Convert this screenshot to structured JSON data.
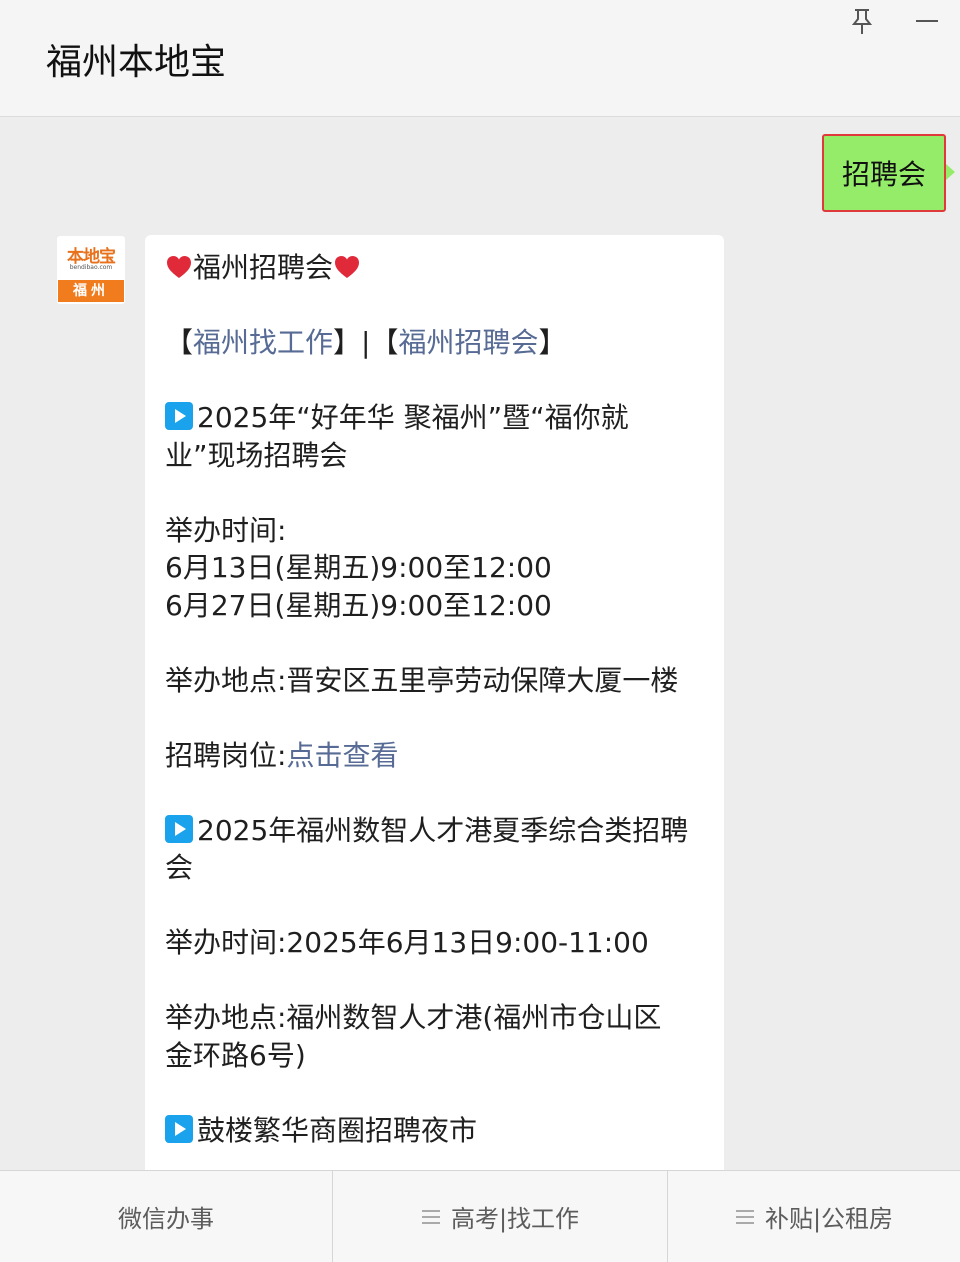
{
  "header": {
    "title": "福州本地宝"
  },
  "window_controls": {
    "pin": "pin-icon",
    "minimize": "minimize-icon"
  },
  "sent_message": {
    "text": "招聘会"
  },
  "avatar": {
    "brand": "本地宝",
    "subtitle": "bendibao.com",
    "city": "福州"
  },
  "article": {
    "title": "福州招聘会",
    "links": {
      "bracket_open": "【",
      "link1": "福州找工作",
      "separator": "】|【",
      "link2": "福州招聘会",
      "bracket_close": "】"
    },
    "event1": {
      "title_line1": "2025年“好年华 聚福州”暨“福你就",
      "title_line2": "业”现场招聘会",
      "time_label": "举办时间:",
      "time1": "6月13日(星期五)9:00至12:00",
      "time2": "6月27日(星期五)9:00至12:00",
      "place": "举办地点:晋安区五里亭劳动保障大厦一楼",
      "jobs_label": "招聘岗位:",
      "jobs_link": "点击查看"
    },
    "event2": {
      "title_line1": "2025年福州数智人才港夏季综合类招聘",
      "title_line2": "会",
      "time": "举办时间:2025年6月13日9:00-11:00",
      "place_line1": "举办地点:福州数智人才港(福州市仓山区",
      "place_line2": "金环路6号)"
    },
    "event3": {
      "title": "鼓楼繁华商圈招聘夜市"
    }
  },
  "tabbar": {
    "tabs": [
      {
        "label": "微信办事"
      },
      {
        "label": "高考|找工作"
      },
      {
        "label": "补贴|公租房"
      }
    ]
  },
  "colors": {
    "link": "#576b95",
    "my_bubble": "#95ec69",
    "highlight_border": "#e0393b",
    "play_icon": "#1aa3ec",
    "heart": "#e02a3a"
  }
}
